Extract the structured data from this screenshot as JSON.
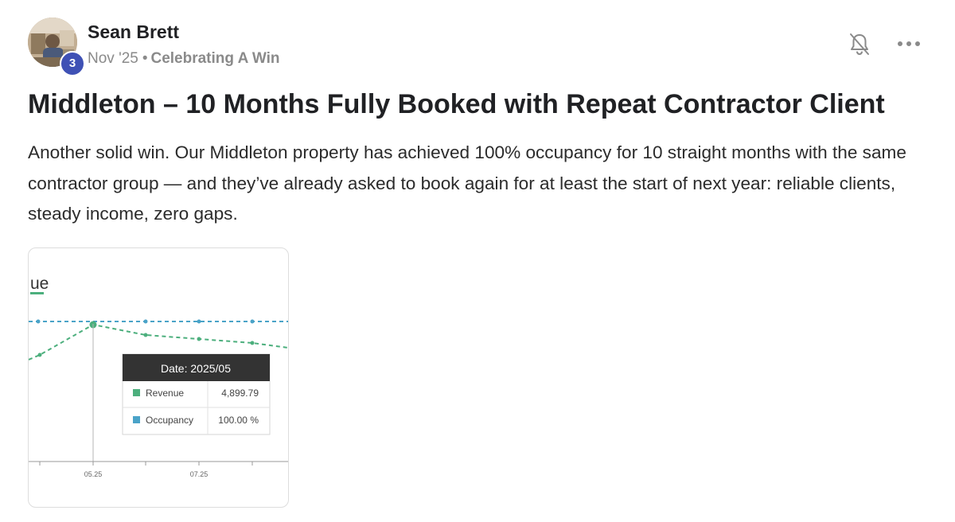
{
  "post": {
    "author": {
      "name": "Sean Brett",
      "level": "3"
    },
    "meta": {
      "date": "Nov '25",
      "separator": "•",
      "category": "Celebrating A Win"
    },
    "title": "Middleton – 10 Months Fully Booked with Repeat Contractor Client",
    "body": "Another solid win. Our Middleton property has achieved 100% occupancy for 10 straight months with the same contractor group — and they’ve already asked to book again for at least the start of next year: reliable clients, steady income, zero gaps.",
    "icons": {
      "notifications": "bell-off-icon",
      "more": "more-horizontal-icon"
    }
  },
  "chart_data": {
    "type": "line",
    "title": "ue",
    "colors": {
      "revenue": "#4caf7d",
      "occupancy": "#4aa3c8"
    },
    "x_tick_labels": [
      "05.25",
      "07.25"
    ],
    "tooltip": {
      "header": "Date: 2025/05",
      "rows": [
        {
          "label": "Revenue",
          "value": "4,899.79"
        },
        {
          "label": "Occupancy",
          "value": "100.00 %"
        }
      ]
    }
  }
}
